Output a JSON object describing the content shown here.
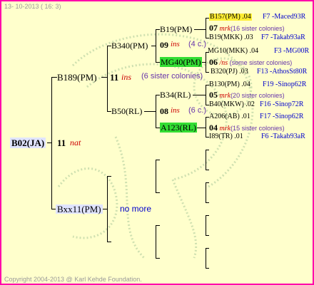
{
  "header": {
    "date": "13- 10-2013 ( 16: 3)"
  },
  "footer": {
    "copyright": "Copyright 2004-2013 @ Karl Kehde Foundation."
  },
  "root": {
    "name": "B02(JA)",
    "num": "11",
    "mark": "nat"
  },
  "gen1": {
    "top": {
      "name": "B189(PM)",
      "num": "11",
      "mark": "ins",
      "note": "(6 sister colonies)"
    },
    "bottom": {
      "name": "Bxx11(PM)",
      "note": "no more"
    }
  },
  "gen2": {
    "a": {
      "name": "B340(PM)"
    },
    "b": {
      "name": "B50(RL)"
    }
  },
  "gen3": {
    "a": {
      "name": "B19(PM)",
      "num": "09",
      "mark": "ins",
      "note": "(4 c.)"
    },
    "b": {
      "name": "MG40(PM)",
      "num": "06",
      "mark": "/ns",
      "note": "(some sister colonies)"
    },
    "c": {
      "name": "B34(RL)",
      "num": "08",
      "mark": "ins",
      "note": "(6 c.)"
    },
    "d": {
      "name": "A123(RL)",
      "num": "04",
      "mark": "mrk",
      "note": "(15 sister colonies)"
    }
  },
  "gen4": [
    {
      "name": "B157(PM)",
      "val": ".04",
      "ref": "F7 -Maced93R"
    },
    {
      "num": "07",
      "mark": "mrk",
      "note": "(16 sister colonies)"
    },
    {
      "name": "B19(MKK)",
      "val": ".03",
      "ref": "F7 -Takab93aR"
    },
    {
      "name": "MG10(MKK)",
      "val": ".04",
      "ref": "F3 -MG00R"
    },
    {
      "name": "B320(PJ)",
      "val": ".03",
      "ref": "F13 -AthosSt80R"
    },
    {
      "name": "B130(PM)",
      "val": ".04",
      "ref": "F19 -Sinop62R"
    },
    {
      "num": "05",
      "mark": "mrk",
      "note": "(20 sister colonies)"
    },
    {
      "name": "B40(MKW)",
      "val": ".02",
      "ref": "F16 -Sinop72R"
    },
    {
      "name": "A206(AB)",
      "val": ".01",
      "ref": "F17 -Sinop62R"
    },
    {
      "name": "I89(TR)",
      "val": ".01",
      "ref": "F6 -Takab93aR"
    }
  ]
}
